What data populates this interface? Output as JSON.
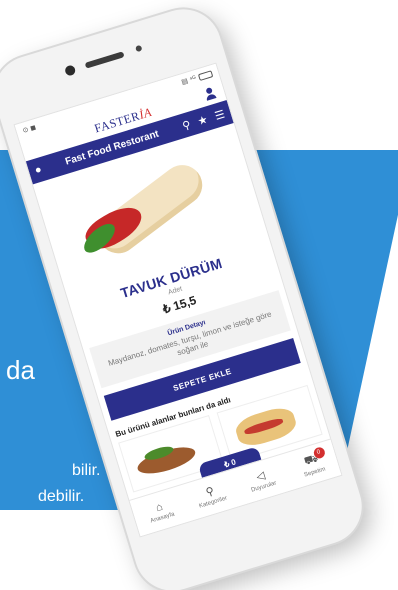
{
  "background": {
    "line1": "da",
    "line2": "bilir.",
    "line3": "debilir."
  },
  "status_bar": {
    "left": "⊙ ◼",
    "right": "▤ ⁴ᴳ"
  },
  "brand": {
    "logo_text": "FASTER",
    "logo_accent": "İA"
  },
  "app_bar": {
    "title": "Fast Food Restorant",
    "search_icon": "search-icon",
    "favorite_icon": "star-icon",
    "filter_icon": "filter-icon"
  },
  "product": {
    "name": "TAVUK DÜRÜM",
    "unit": "Adet",
    "price": "₺ 15,5",
    "detail_title": "Ürün Detayı",
    "detail_text": "Maydanoz, domates, turşu, limon ve isteğe göre soğan ile"
  },
  "actions": {
    "add_to_cart": "SEPETE EKLE"
  },
  "related": {
    "title": "Bu ürünü alanlar bunları da aldı"
  },
  "cart_summary": {
    "total": "₺ 0"
  },
  "tabs": [
    {
      "label": "Anasayfa",
      "icon": "home-icon"
    },
    {
      "label": "Kategoriler",
      "icon": "search-icon"
    },
    {
      "label": "Duyurular",
      "icon": "megaphone-icon"
    },
    {
      "label": "Sepetim",
      "icon": "cart-icon",
      "badge": "0"
    }
  ],
  "colors": {
    "primary": "#2b2f8c",
    "background_band": "#2f8fd6",
    "badge": "#d32f2f"
  }
}
